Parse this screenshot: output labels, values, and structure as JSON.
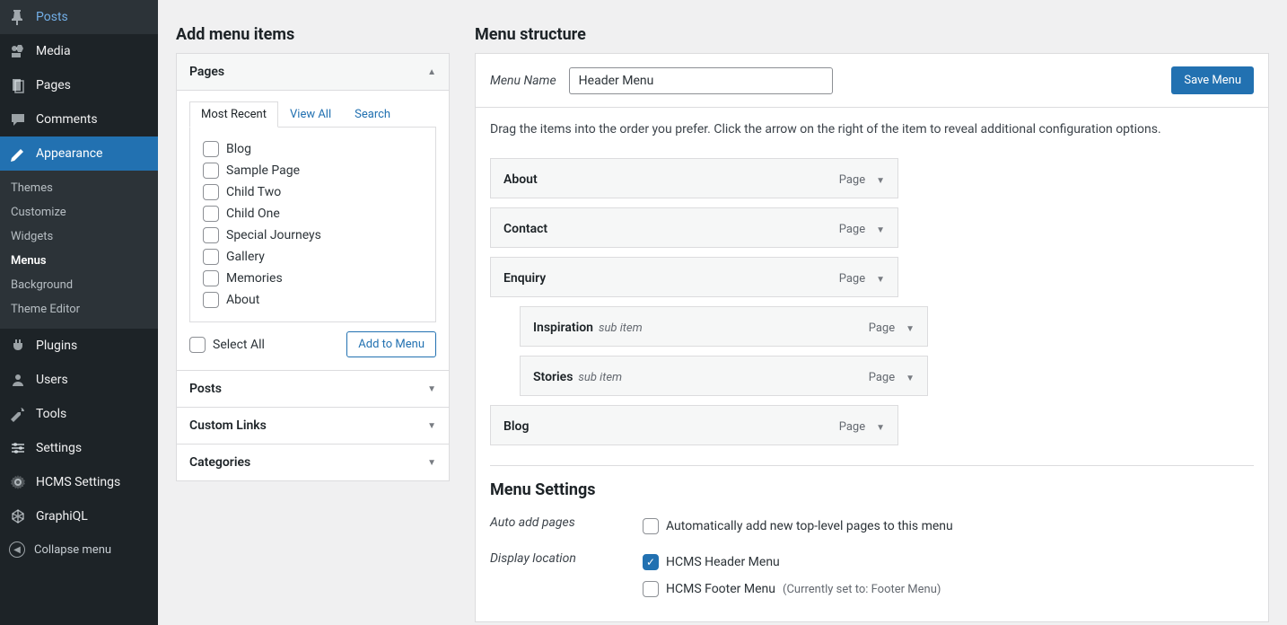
{
  "sidebar": {
    "items": [
      {
        "icon": "pin",
        "label": "Posts"
      },
      {
        "icon": "media",
        "label": "Media"
      },
      {
        "icon": "pages",
        "label": "Pages"
      },
      {
        "icon": "comment",
        "label": "Comments"
      },
      {
        "icon": "appearance",
        "label": "Appearance",
        "active": true
      },
      {
        "icon": "plugins",
        "label": "Plugins"
      },
      {
        "icon": "users",
        "label": "Users"
      },
      {
        "icon": "tools",
        "label": "Tools"
      },
      {
        "icon": "settings",
        "label": "Settings"
      },
      {
        "icon": "gear",
        "label": "HCMS Settings"
      },
      {
        "icon": "graphql",
        "label": "GraphiQL"
      }
    ],
    "submenu": [
      "Themes",
      "Customize",
      "Widgets",
      "Menus",
      "Background",
      "Theme Editor"
    ],
    "submenu_current": "Menus",
    "collapse": "Collapse menu"
  },
  "left": {
    "heading": "Add menu items",
    "groups": [
      "Pages",
      "Posts",
      "Custom Links",
      "Categories"
    ],
    "tabs": [
      "Most Recent",
      "View All",
      "Search"
    ],
    "active_tab": "Most Recent",
    "pages": [
      "Blog",
      "Sample Page",
      "Child Two",
      "Child One",
      "Special Journeys",
      "Gallery",
      "Memories",
      "About"
    ],
    "select_all": "Select All",
    "add_btn": "Add to Menu"
  },
  "right": {
    "heading": "Menu structure",
    "name_label": "Menu Name",
    "name_value": "Header Menu",
    "save_btn": "Save Menu",
    "instructions": "Drag the items into the order you prefer. Click the arrow on the right of the item to reveal additional configuration options.",
    "items": [
      {
        "label": "About",
        "type": "Page",
        "depth": 0
      },
      {
        "label": "Contact",
        "type": "Page",
        "depth": 0
      },
      {
        "label": "Enquiry",
        "type": "Page",
        "depth": 0
      },
      {
        "label": "Inspiration",
        "type": "Page",
        "depth": 1,
        "subtxt": "sub item"
      },
      {
        "label": "Stories",
        "type": "Page",
        "depth": 1,
        "subtxt": "sub item"
      },
      {
        "label": "Blog",
        "type": "Page",
        "depth": 0
      }
    ],
    "settings_heading": "Menu Settings",
    "settings": {
      "auto_label": "Auto add pages",
      "auto_txt": "Automatically add new top-level pages to this menu",
      "loc_label": "Display location",
      "loc1": "HCMS Header Menu",
      "loc2": "HCMS Footer Menu",
      "loc2_note": "(Currently set to: Footer Menu)"
    }
  }
}
